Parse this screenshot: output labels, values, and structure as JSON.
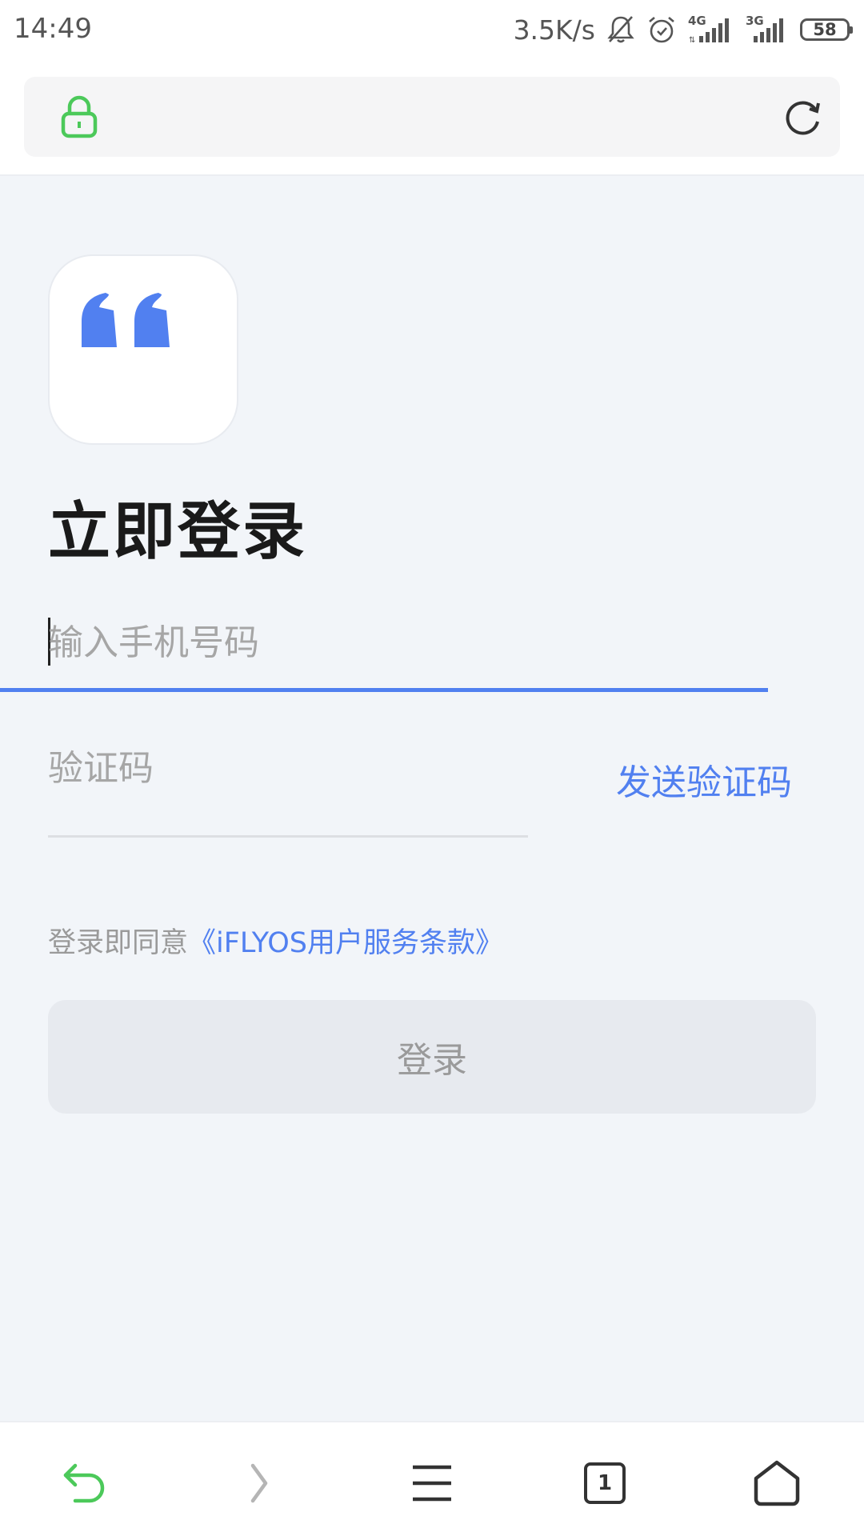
{
  "status_bar": {
    "time": "14:49",
    "speed": "3.5K/s",
    "network_1": "4G",
    "network_2": "3G",
    "battery": "58"
  },
  "browser": {
    "url": ""
  },
  "page": {
    "title": "立即登录",
    "phone_placeholder": "输入手机号码",
    "code_placeholder": "验证码",
    "send_code_label": "发送验证码",
    "agreement_prefix": "登录即同意",
    "agreement_link": "《iFLYOS用户服务条款》",
    "login_label": "登录"
  },
  "bottom_nav": {
    "tab_count": "1"
  },
  "colors": {
    "accent": "#5180f0",
    "lock_green": "#4cc95a",
    "back_green": "#4cc95a",
    "page_bg": "#f2f5f9"
  },
  "icons": [
    "lock-icon",
    "reload-icon",
    "back-icon",
    "forward-icon",
    "menu-icon",
    "tabs-icon",
    "home-icon",
    "quote-logo-icon"
  ]
}
